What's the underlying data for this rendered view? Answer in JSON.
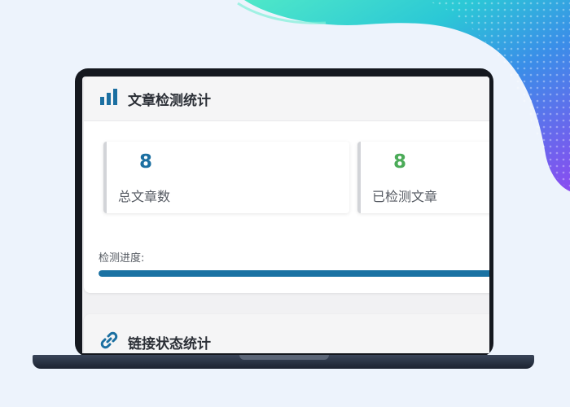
{
  "colors": {
    "accent_blue": "#1b6fa1",
    "accent_green": "#4bab58",
    "progress_fill": "#1a72a3"
  },
  "panels": [
    {
      "icon": "bar-chart-icon",
      "title": "文章检测统计",
      "cards": [
        {
          "value": "8",
          "label": "总文章数",
          "color": "blue"
        },
        {
          "value": "8",
          "label": "已检测文章",
          "color": "green"
        }
      ],
      "progress": {
        "label": "检测进度:",
        "percent": 100
      }
    },
    {
      "icon": "link-icon",
      "title": "链接状态统计"
    }
  ]
}
